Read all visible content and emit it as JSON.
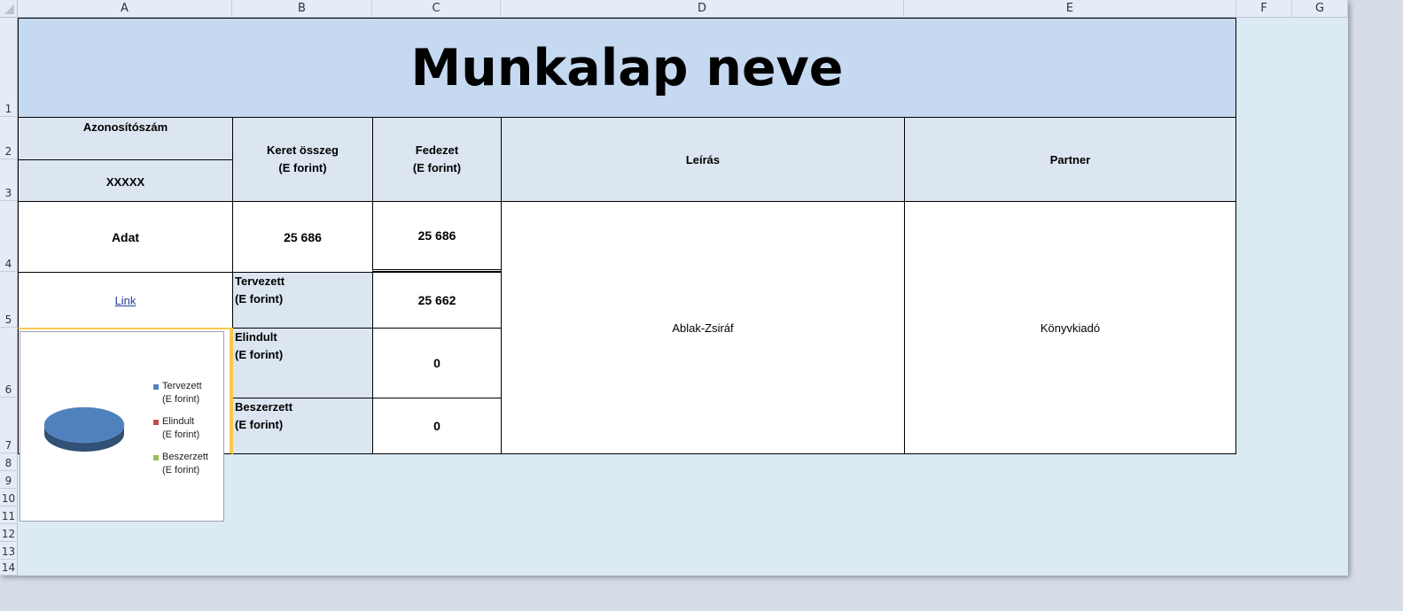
{
  "columns": [
    "A",
    "B",
    "C",
    "D",
    "E",
    "F",
    "G"
  ],
  "rows": [
    "1",
    "2",
    "3",
    "4",
    "5",
    "6",
    "7",
    "8",
    "9",
    "10",
    "11",
    "12",
    "13",
    "14"
  ],
  "sheet": {
    "title": "Munkalap neve",
    "id_label": "Azonosítószám",
    "id_value": "XXXXX",
    "keret_header_line1": "Keret összeg",
    "keret_header_line2": "(E forint)",
    "fedezet_header_line1": "Fedezet",
    "fedezet_header_line2": "(E forint)",
    "leiras_header": "Leírás",
    "partner_header": "Partner",
    "adat_label": "Adat",
    "keret_value": "25 686",
    "fedezet_value": "25 686",
    "link_text": "Link",
    "tervezett_label_line1": "Tervezett",
    "tervezett_label_line2": "(E forint)",
    "tervezett_value": "25 662",
    "elindult_label_line1": "Elindult",
    "elindult_label_line2": "(E forint)",
    "elindult_value": "0",
    "beszerzett_label_line1": "Beszerzett",
    "beszerzett_label_line2": "(E forint)",
    "beszerzett_value": "0",
    "leiras_value": "Ablak-Zsiráf",
    "partner_value": "Könyvkiadó"
  },
  "chart_data": {
    "type": "pie",
    "categories": [
      "Tervezett (E forint)",
      "Elindult (E forint)",
      "Beszerzett (E forint)"
    ],
    "values": [
      25662,
      0,
      0
    ],
    "legend_position": "right",
    "legend": [
      {
        "line1": "Tervezett",
        "line2": "(E forint)",
        "color": "#4f81bd"
      },
      {
        "line1": "Elindult",
        "line2": "(E forint)",
        "color": "#c0504d"
      },
      {
        "line1": "Beszerzett",
        "line2": "(E forint)",
        "color": "#9bbb59"
      }
    ]
  },
  "colors": {
    "title_fill": "#c5d9f1",
    "header_fill": "#dce6f1",
    "sheet_background": "#dbeaf3",
    "selection_border": "#f8c94d"
  }
}
